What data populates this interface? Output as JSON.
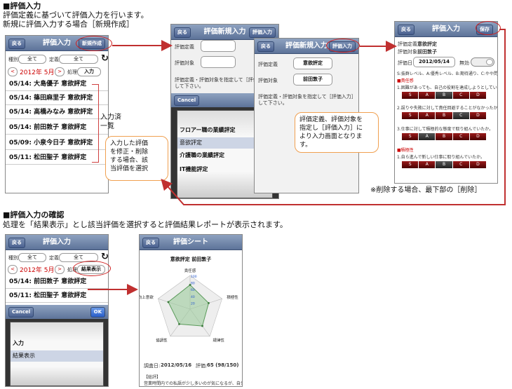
{
  "section1": {
    "heading": "■評価入力",
    "line1": "評価定義に基づいて評価入力を行います。",
    "line2": "新規に評価入力する場合［新規作成］"
  },
  "section2": {
    "heading": "■評価入力の確認",
    "line1": "処理を「結果表示」とし該当評価を選択すると評価結果レポートが表示されます。"
  },
  "note_delete": "※削除する場合、最下部の［削除］",
  "callout_list_label": "入力済\n一覧",
  "callout_edit": "入力した評価\nを修正・削除\nする場合、該\n当評価を選択",
  "callout_define": "評価定義、評価対象を\n指定し［評価入力］に\nより入力画面となりま\nす。",
  "s1": {
    "back": "戻る",
    "title": "評価入力",
    "new_btn": "新規作成",
    "type_lbl": "種別",
    "type_val": "全て",
    "def_lbl": "定義",
    "def_val": "全て",
    "month": "2012年 5月",
    "proc_lbl": "処理",
    "proc_val": "入力",
    "rows": [
      "05/14: 大島優子 意欲評定",
      "05/14: 篠田麻里子 意欲評定",
      "05/14: 高橋みなみ 意欲評定",
      "05/14: 前田敦子 意欲評定",
      "05/09: 小泉今日子 意欲評定",
      "05/11: 松田聖子 意欲評定"
    ]
  },
  "s2": {
    "back": "戻る",
    "title": "評価新規入力",
    "input_btn": "評価入力",
    "def_lbl": "評価定義",
    "target_lbl": "評価対象",
    "hint": "評価定義・評価対象を指定して［評価入力］して下さい。",
    "cancel": "Cancel",
    "picker": [
      "フロアー職の業績評定",
      "意欲評定",
      "介護職の業績評定",
      "IT機能評定"
    ]
  },
  "s3": {
    "back": "戻る",
    "title": "評価新規入力",
    "input_btn": "評価入力",
    "def_lbl": "評価定義",
    "def_val": "意欲評定",
    "target_lbl": "評価対象",
    "target_val": "前田敦子",
    "hint": "評価定義・評価対象を指定して［評価入力］して下さい。"
  },
  "s4": {
    "back": "戻る",
    "title": "評価入力",
    "save": "保存",
    "def_lbl": "評価定義",
    "def_val": "意欲評定",
    "target_lbl": "評価対象",
    "target_val": "前田敦子",
    "date_lbl": "評価日",
    "date_val": "2012/05/14",
    "invalid_lbl": "無効",
    "scale": "S:抜群レベル、A:優秀レベル、B:期待通り、C:やや問題あり",
    "grp1": "■責任感",
    "q1": "1.困難があっても、自己の役割を達成しようとしていたか。",
    "q2": "2.誤りや失敗に対して責任回避することがなかったか。",
    "q3": "3.仕事に対して積極的な態度で取り組んでいたか。",
    "grp2": "■積極性",
    "q4": "1.自ら進んで新しい仕事に取り組んでいたか。",
    "grades": [
      "S",
      "A",
      "B",
      "C",
      "D"
    ]
  },
  "s5": {
    "back": "戻る",
    "title": "評価入力",
    "type_lbl": "種別",
    "type_val": "全て",
    "def_lbl": "定義",
    "def_val": "全て",
    "month": "2012年 5月",
    "proc_lbl": "処理",
    "proc_val": "結果表示",
    "rows": [
      "05/14: 前田敦子 意欲評定",
      "05/11: 松田聖子 意欲評定"
    ],
    "cancel": "Cancel",
    "ok": "OK",
    "picker": [
      "入力",
      "結果表示"
    ]
  },
  "s6": {
    "back": "戻る",
    "title": "評価シート",
    "chart_title": "意欲評定 前田敦子",
    "date_lbl": "調査日:",
    "date_val": "2012/05/16",
    "score_lbl": "評価:",
    "score_val": "65 (98/150)",
    "comment_lbl": "【総評】",
    "comment": "営業時間内での私語が少し多いのが気になるが、自分を客"
  },
  "chart_data": {
    "type": "radar",
    "axes": [
      "責任感",
      "積極性",
      "規律性",
      "協調性",
      "能力向上意欲"
    ],
    "ticks": [
      "100",
      "80",
      "60",
      "40",
      "20"
    ],
    "rmax": 100,
    "values": [
      72,
      58,
      62,
      55,
      68
    ]
  }
}
